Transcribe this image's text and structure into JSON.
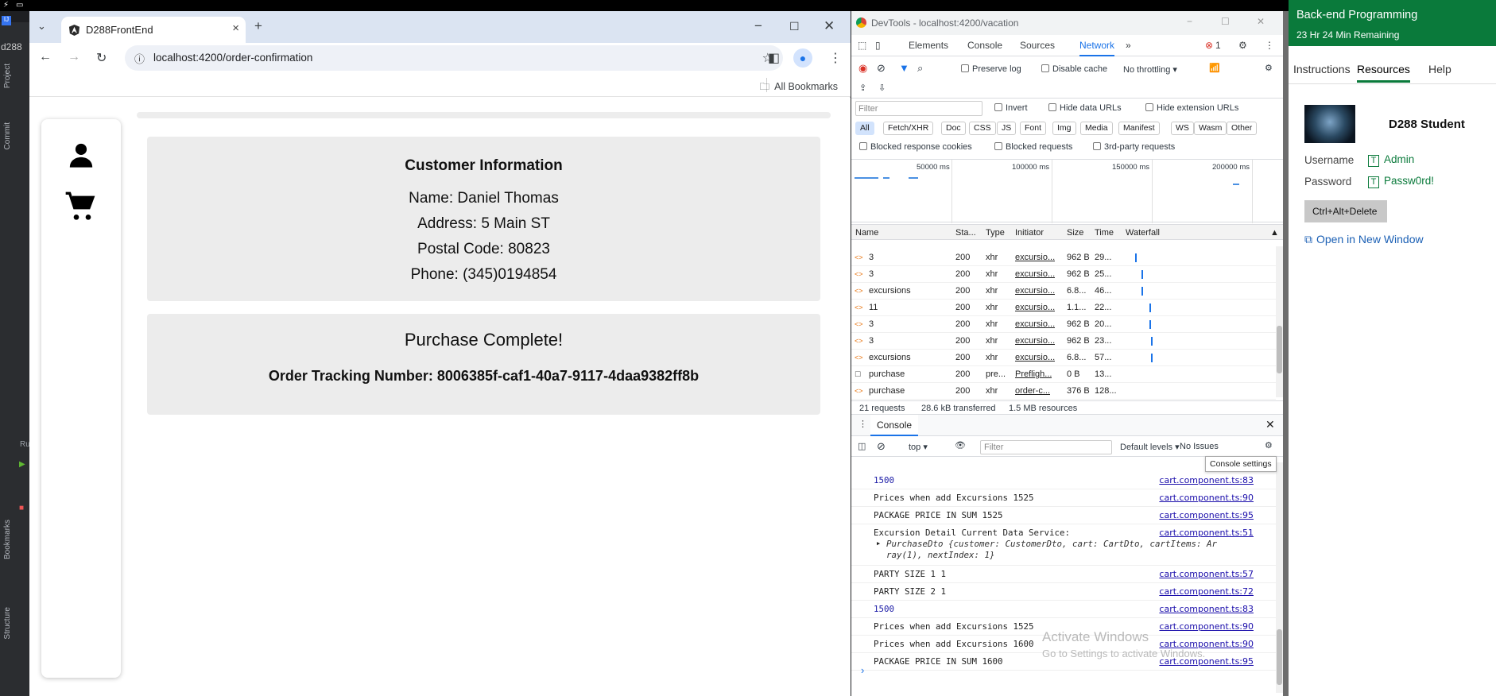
{
  "ide": {
    "title": "d288",
    "project": "Project",
    "commit": "Commit",
    "bookmarks": "Bookmarks",
    "structure": "Structure",
    "run": "Ru"
  },
  "browser": {
    "tab_title": "D288FrontEnd",
    "url": "localhost:4200/order-confirmation",
    "all_bookmarks": "All Bookmarks"
  },
  "customer": {
    "heading": "Customer Information",
    "name": "Name: Daniel Thomas",
    "address": "Address: 5 Main ST",
    "postal": "Postal Code: 80823",
    "phone": "Phone: (345)0194854"
  },
  "purchase": {
    "heading": "Purchase Complete!",
    "tracking": "Order Tracking Number: 8006385f-caf1-40a7-9117-4daa9382ff8b"
  },
  "devtools": {
    "window_title": "DevTools - localhost:4200/vacation",
    "tabs": [
      "Elements",
      "Console",
      "Sources",
      "Network"
    ],
    "error_count": "1",
    "preserve_log": "Preserve log",
    "disable_cache": "Disable cache",
    "throttling": "No throttling",
    "filter_placeholder": "Filter",
    "invert": "Invert",
    "hide_data_urls": "Hide data URLs",
    "hide_ext_urls": "Hide extension URLs",
    "type_filters": [
      "All",
      "Fetch/XHR",
      "Doc",
      "CSS",
      "JS",
      "Font",
      "Img",
      "Media",
      "Manifest",
      "WS",
      "Wasm",
      "Other"
    ],
    "blocked_cookies": "Blocked response cookies",
    "blocked_requests": "Blocked requests",
    "third_party": "3rd-party requests",
    "timeline_ticks": [
      "50000 ms",
      "100000 ms",
      "150000 ms",
      "200000 ms"
    ],
    "columns": [
      "Name",
      "Sta...",
      "Type",
      "Initiator",
      "Size",
      "Time",
      "Waterfall"
    ],
    "requests": [
      {
        "name": "3",
        "status": "200",
        "type": "xhr",
        "initiator": "excursio...",
        "size": "962 B",
        "time": "29..."
      },
      {
        "name": "3",
        "status": "200",
        "type": "xhr",
        "initiator": "excursio...",
        "size": "962 B",
        "time": "25..."
      },
      {
        "name": "excursions",
        "status": "200",
        "type": "xhr",
        "initiator": "excursio...",
        "size": "6.8...",
        "time": "46..."
      },
      {
        "name": "11",
        "status": "200",
        "type": "xhr",
        "initiator": "excursio...",
        "size": "1.1...",
        "time": "22..."
      },
      {
        "name": "3",
        "status": "200",
        "type": "xhr",
        "initiator": "excursio...",
        "size": "962 B",
        "time": "20..."
      },
      {
        "name": "3",
        "status": "200",
        "type": "xhr",
        "initiator": "excursio...",
        "size": "962 B",
        "time": "23..."
      },
      {
        "name": "excursions",
        "status": "200",
        "type": "xhr",
        "initiator": "excursio...",
        "size": "6.8...",
        "time": "57..."
      },
      {
        "name": "purchase",
        "status": "200",
        "type": "pre...",
        "initiator": "Prefligh...",
        "size": "0 B",
        "time": "13..."
      },
      {
        "name": "purchase",
        "status": "200",
        "type": "xhr",
        "initiator": "order-c...",
        "size": "376 B",
        "time": "128..."
      }
    ],
    "summary_requests": "21 requests",
    "summary_transferred": "28.6 kB transferred",
    "summary_resources": "1.5 MB resources",
    "console_tab": "Console",
    "context": "top",
    "console_filter": "Filter",
    "levels": "Default levels",
    "issues": "No Issues",
    "tooltip": "Console settings",
    "logs": [
      {
        "msg": "1500",
        "src": "cart.component.ts:83",
        "blue": true
      },
      {
        "msg": "Prices when add Excursions 1525",
        "src": "cart.component.ts:90"
      },
      {
        "msg": "PACKAGE PRICE IN SUM 1525",
        "src": "cart.component.ts:95"
      },
      {
        "msg": "Excursion Detail Current Data Service:",
        "src": "cart.component.ts:51",
        "obj": "PurchaseDto {customer: CustomerDto, cart: CartDto, cartItems: Ar",
        "obj2": "ray(1), nextIndex: 1}"
      },
      {
        "msg": "PARTY SIZE 1 1",
        "src": "cart.component.ts:57"
      },
      {
        "msg": "PARTY SIZE 2 1",
        "src": "cart.component.ts:72"
      },
      {
        "msg": "1500",
        "src": "cart.component.ts:83",
        "blue": true
      },
      {
        "msg": "Prices when add Excursions 1525",
        "src": "cart.component.ts:90"
      },
      {
        "msg": "Prices when add Excursions 1600",
        "src": "cart.component.ts:90"
      },
      {
        "msg": "PACKAGE PRICE IN SUM 1600",
        "src": "cart.component.ts:95"
      }
    ],
    "watermark1": "Activate Windows",
    "watermark2": "Go to Settings to activate Windows."
  },
  "lab": {
    "title": "Back-end Programming",
    "remaining": "23 Hr 24 Min Remaining",
    "tabs": [
      "Instructions",
      "Resources",
      "Help"
    ],
    "active_tab": "Resources",
    "student": "D288 Student",
    "username_label": "Username",
    "username": "Admin",
    "password_label": "Password",
    "password": "Passw0rd!",
    "cad_button": "Ctrl+Alt+Delete",
    "open_window": "Open in New Window",
    "accent": "#0a7a3b"
  }
}
